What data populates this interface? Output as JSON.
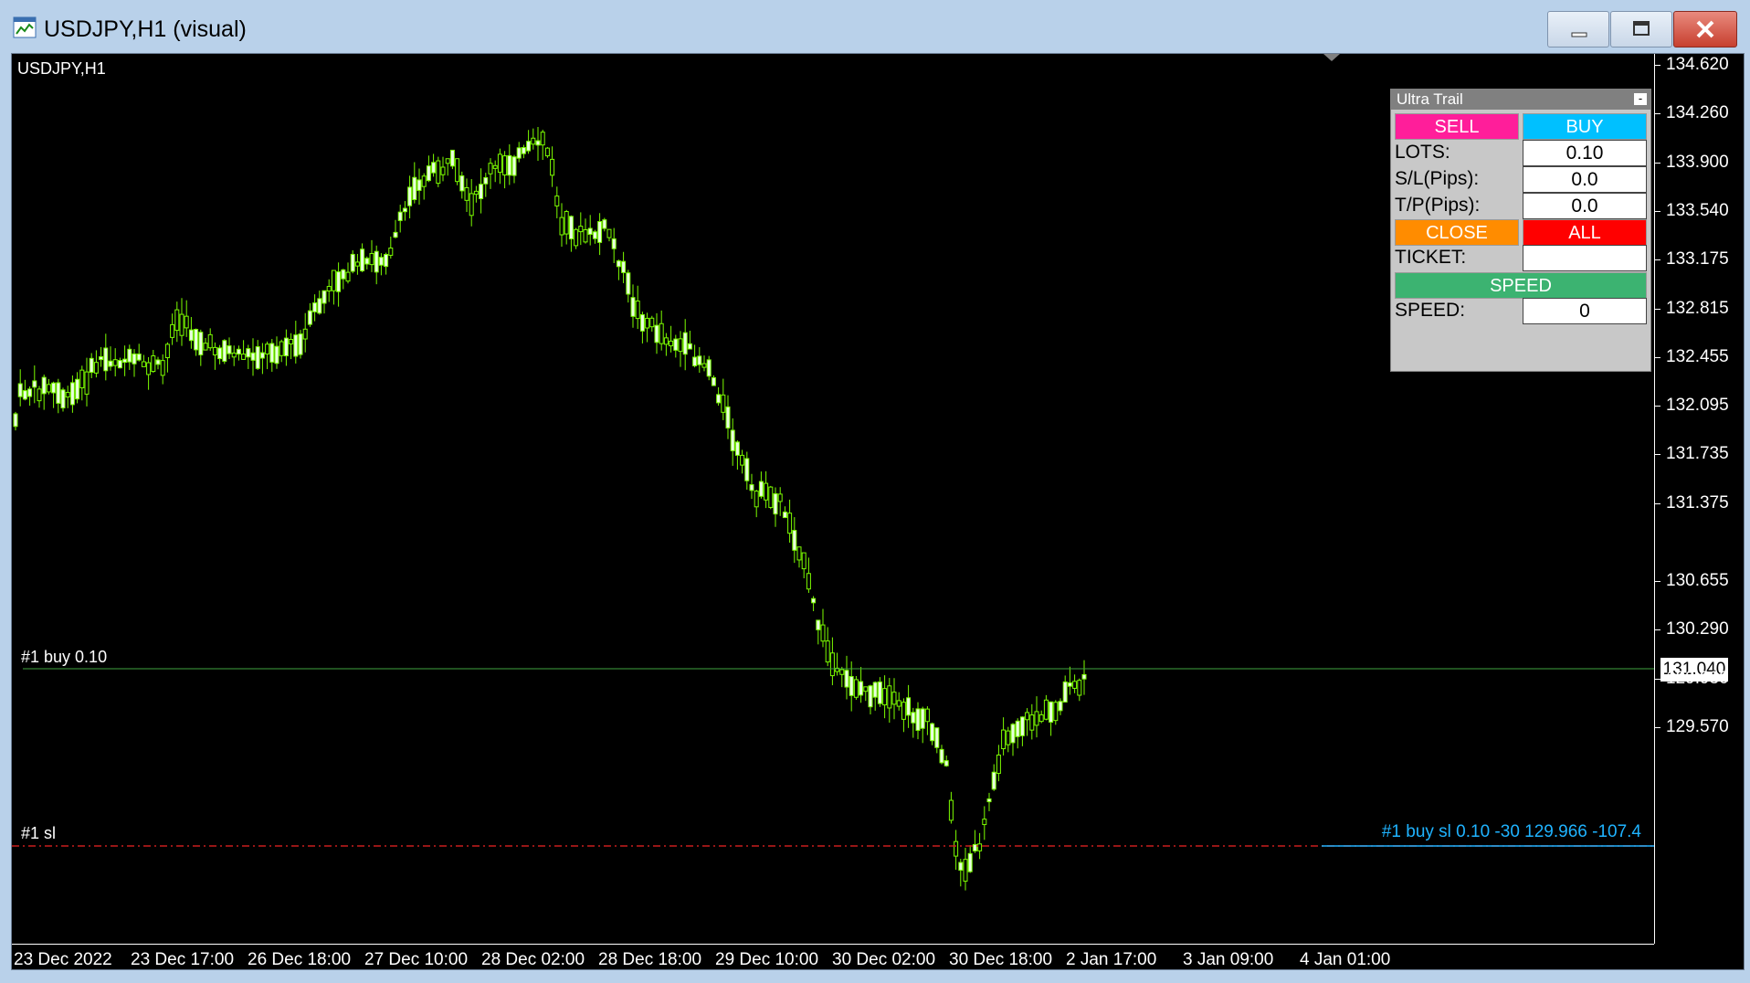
{
  "window": {
    "title": "USDJPY,H1 (visual)",
    "minimize_label": "",
    "maximize_label": "",
    "close_label": ""
  },
  "chart": {
    "symbol_label": "USDJPY,H1",
    "bull_color": "#7CFC00",
    "price_ticks": [
      "134.620",
      "134.260",
      "133.900",
      "133.540",
      "133.175",
      "132.815",
      "132.455",
      "132.095",
      "131.735",
      "131.375",
      "131.040",
      "130.655",
      "130.290",
      "129.930",
      "129.570"
    ],
    "current_price": "131.040",
    "time_ticks": [
      "23 Dec 2022",
      "23 Dec 17:00",
      "26 Dec 18:00",
      "27 Dec 10:00",
      "28 Dec 02:00",
      "28 Dec 18:00",
      "29 Dec 10:00",
      "30 Dec 02:00",
      "30 Dec 18:00",
      "2 Jan 17:00",
      "3 Jan 09:00",
      "4 Jan 01:00"
    ],
    "buy_order_label": "#1 buy 0.10",
    "buy_order_line_color": "#3fa33f",
    "sl_label": "#1 sl",
    "sl_line_color": "#c81e1e",
    "sl_info": "#1  buy sl  0.10  -30  129.966  -107.4",
    "sl_info_color": "#1fb3ff"
  },
  "panel": {
    "title": "Ultra Trail",
    "minimize_symbol": "-",
    "sell_label": "SELL",
    "sell_color": "#ff1e9a",
    "buy_label": "BUY",
    "buy_color": "#00c0ff",
    "lots_label": "LOTS:",
    "lots_value": "0.10",
    "sl_label": "S/L(Pips):",
    "sl_value": "0.0",
    "tp_label": "T/P(Pips):",
    "tp_value": "0.0",
    "close_label": "CLOSE",
    "close_color": "#ff8c00",
    "all_label": "ALL",
    "all_color": "#ff0000",
    "ticket_label": "TICKET:",
    "ticket_value": "",
    "speed_button_label": "SPEED",
    "speed_button_color": "#3cb371",
    "speed_label": "SPEED:",
    "speed_value": "0"
  }
}
